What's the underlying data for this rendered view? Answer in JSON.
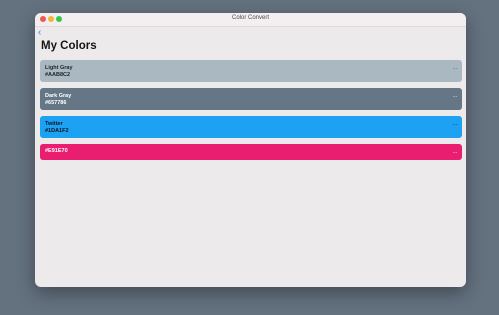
{
  "window": {
    "title": "Color Convert"
  },
  "nav": {
    "back_icon": "chevron-left-icon",
    "back_glyph": "‹"
  },
  "page": {
    "title": "My Colors"
  },
  "colors": [
    {
      "name": "Light Gray",
      "hex": "#AAB8C2",
      "color": "#AAB8C2",
      "more": "···"
    },
    {
      "name": "Dark Gray",
      "hex": "#657786",
      "color": "#657786",
      "more": "···"
    },
    {
      "name": "Twitter",
      "hex": "#1DA1F2",
      "color": "#1DA1F2",
      "more": "···"
    },
    {
      "name": "",
      "hex": "#E91E70",
      "color": "#E91E70",
      "more": "···"
    }
  ]
}
